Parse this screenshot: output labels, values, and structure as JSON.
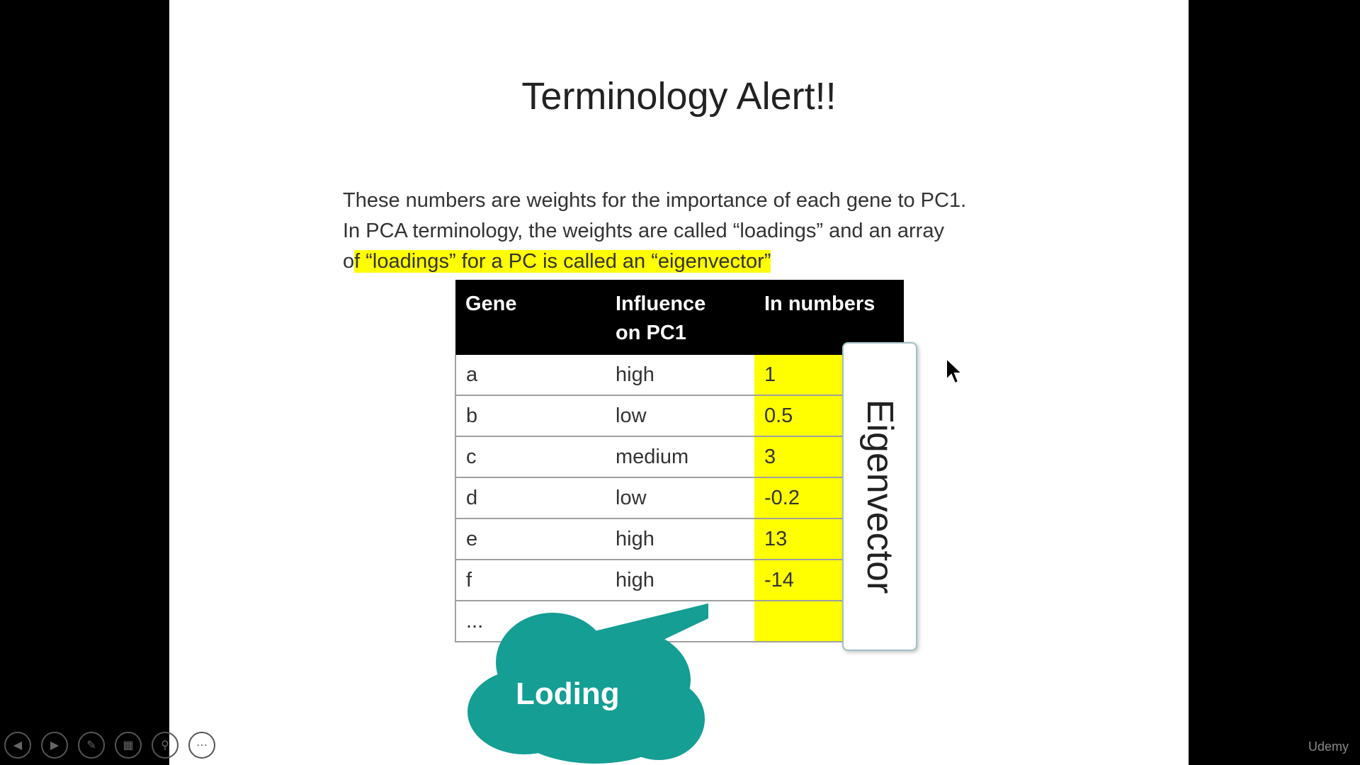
{
  "slide": {
    "title": "Terminology Alert!!",
    "paragraph": {
      "line1": "These numbers are weights for the importance of each gene to PC1.",
      "line2": "In PCA terminology, the weights are called “loadings” and an array",
      "line3_plain": "o",
      "line3_highlight": "f “loadings” for a PC is called an “eigenvector”"
    },
    "table": {
      "headers": [
        "Gene",
        "Influence on PC1",
        "In numbers"
      ],
      "header_influence_line1": "Influence",
      "header_influence_line2": "on PC1",
      "rows": [
        {
          "gene": "a",
          "influence": "high",
          "number": "1"
        },
        {
          "gene": "b",
          "influence": "low",
          "number": "0.5"
        },
        {
          "gene": "c",
          "influence": "medium",
          "number": "3"
        },
        {
          "gene": "d",
          "influence": "low",
          "number": "-0.2"
        },
        {
          "gene": "e",
          "influence": "high",
          "number": "13"
        },
        {
          "gene": "f",
          "influence": "high",
          "number": "-14"
        },
        {
          "gene": "...",
          "influence": "...",
          "number": ""
        }
      ]
    },
    "eigenvector_label": "Eigenvector",
    "loading_callout": "Loding"
  },
  "controls": {
    "icons": [
      "prev-icon",
      "next-icon",
      "pen-icon",
      "slides-icon",
      "zoom-icon",
      "more-icon"
    ]
  },
  "brand": "Udemy",
  "colors": {
    "highlight": "#ffff00",
    "callout": "#149e94",
    "header_bg": "#000000"
  }
}
